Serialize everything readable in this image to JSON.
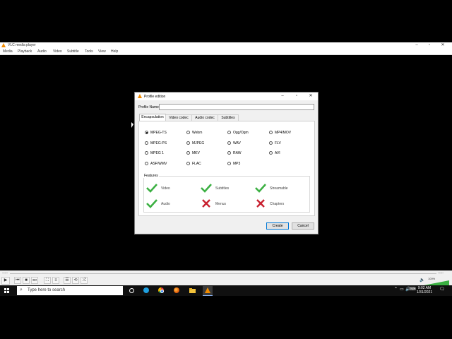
{
  "vlc": {
    "title": "VLC media player",
    "menu": [
      "Media",
      "Playback",
      "Audio",
      "Video",
      "Subtitle",
      "Tools",
      "View",
      "Help"
    ],
    "time_elapsed": "--:--",
    "time_total": "--:--",
    "volume": "100%"
  },
  "dialog": {
    "title": "Profile edition",
    "profile_name_label": "Profile Name",
    "profile_name_value": "",
    "tabs": [
      "Encapsulation",
      "Video codec",
      "Audio codec",
      "Subtitles"
    ],
    "active_tab": "Encapsulation",
    "encapsulations": [
      {
        "label": "MPEG-TS",
        "checked": true
      },
      {
        "label": "Webm",
        "checked": false
      },
      {
        "label": "Ogg/Ogm",
        "checked": false
      },
      {
        "label": "MP4/MOV",
        "checked": false
      },
      {
        "label": "MPEG-PS",
        "checked": false
      },
      {
        "label": "MJPEG",
        "checked": false
      },
      {
        "label": "WAV",
        "checked": false
      },
      {
        "label": "FLV",
        "checked": false
      },
      {
        "label": "MPEG 1",
        "checked": false
      },
      {
        "label": "MKV",
        "checked": false
      },
      {
        "label": "RAW",
        "checked": false
      },
      {
        "label": "AVI",
        "checked": false
      },
      {
        "label": "ASF/WMV",
        "checked": false
      },
      {
        "label": "FLAC",
        "checked": false
      },
      {
        "label": "MP3",
        "checked": false
      }
    ],
    "features_title": "Features",
    "features": [
      {
        "label": "Video",
        "supported": true
      },
      {
        "label": "Subtitles",
        "supported": true
      },
      {
        "label": "Streamable",
        "supported": true
      },
      {
        "label": "Audio",
        "supported": true
      },
      {
        "label": "Menus",
        "supported": false
      },
      {
        "label": "Chapters",
        "supported": false
      }
    ],
    "create_label": "Create",
    "cancel_label": "Cancel"
  },
  "taskbar": {
    "search_placeholder": "Type here to search",
    "time": "9:02 AM",
    "date": "1/31/2021"
  },
  "colors": {
    "vlc_orange": "#f28c00",
    "check_green": "#3cb043",
    "cross_red": "#c8202f",
    "focus_blue": "#0078d7"
  }
}
